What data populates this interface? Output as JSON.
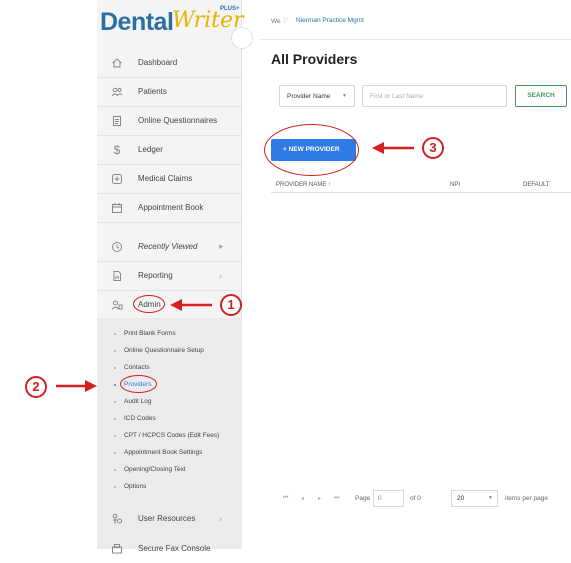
{
  "app": {
    "logo_dental": "Dental",
    "logo_writer": "Writer",
    "logo_plus": "PLUS+"
  },
  "topbar": {
    "welcome": "We",
    "practice": "Nierman Practice Mgmt"
  },
  "sidebar": {
    "items": [
      {
        "label": "Dashboard",
        "icon": "home-icon"
      },
      {
        "label": "Patients",
        "icon": "patients-icon"
      },
      {
        "label": "Online Questionnaires",
        "icon": "document-icon"
      },
      {
        "label": "Ledger",
        "icon": "dollar-icon"
      },
      {
        "label": "Medical Claims",
        "icon": "plus-square-icon"
      },
      {
        "label": "Appointment Book",
        "icon": "calendar-icon"
      },
      {
        "label": "Recently Viewed",
        "icon": "clock-icon"
      },
      {
        "label": "Reporting",
        "icon": "report-icon"
      },
      {
        "label": "Admin",
        "icon": "admin-icon"
      }
    ],
    "admin_sub": [
      "Print Blank Forms",
      "Online Questionnaire Setup",
      "Contacts",
      "Providers",
      "Audit Log",
      "ICD Codes",
      "CPT / HCPCS Codes (Edit Fees)",
      "Appointment Book Settings",
      "Opening/Closing Text",
      "Options"
    ],
    "user_resources": "User Resources",
    "secure_fax": "Secure Fax Console"
  },
  "main": {
    "title": "All Providers",
    "filter_select": "Provider Name",
    "search_placeholder": "First or Last Name",
    "search_button": "SEARCH",
    "new_provider_button": "+ NEW PROVIDER",
    "columns": [
      "PROVIDER NAME",
      "NPI",
      "DEFAULT"
    ],
    "sort_indicator": "↑"
  },
  "pager": {
    "page_label": "Page",
    "page_value": "0",
    "of_label": "of 0",
    "page_size": "20",
    "items_per_page": "items per page"
  },
  "annotations": [
    "1",
    "2",
    "3"
  ],
  "colors": {
    "accent_blue": "#2f7be6",
    "brand_blue": "#2b6fa3",
    "search_green": "#3c9a5b",
    "annotation_red": "#d42020"
  }
}
